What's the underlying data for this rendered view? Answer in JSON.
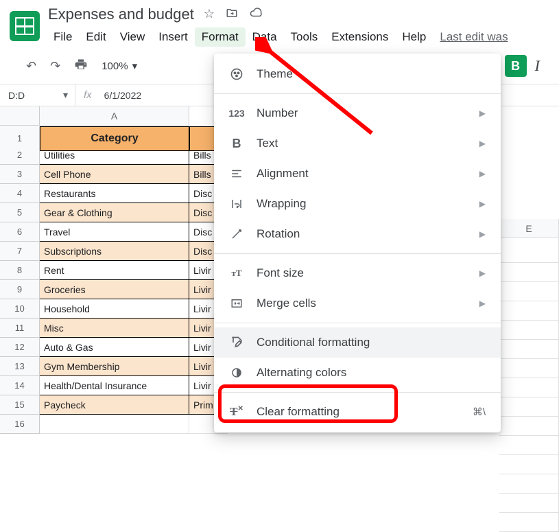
{
  "doc": {
    "title": "Expenses and budget",
    "last_edit": "Last edit was"
  },
  "menubar": [
    "File",
    "Edit",
    "View",
    "Insert",
    "Format",
    "Data",
    "Tools",
    "Extensions",
    "Help"
  ],
  "toolbar": {
    "zoom": "100%"
  },
  "formula": {
    "name_box": "D:D",
    "value": "6/1/2022"
  },
  "columns": {
    "A": "A",
    "E": "E"
  },
  "header_row": {
    "A": "Category"
  },
  "rows": [
    {
      "n": "2",
      "a": "Utilities",
      "b": "Bills"
    },
    {
      "n": "3",
      "a": "Cell Phone",
      "b": "Bills",
      "alt": true
    },
    {
      "n": "4",
      "a": "Restaurants",
      "b": "Disc"
    },
    {
      "n": "5",
      "a": "Gear & Clothing",
      "b": "Disc",
      "alt": true
    },
    {
      "n": "6",
      "a": "Travel",
      "b": "Disc"
    },
    {
      "n": "7",
      "a": "Subscriptions",
      "b": "Disc",
      "alt": true
    },
    {
      "n": "8",
      "a": "Rent",
      "b": "Livir"
    },
    {
      "n": "9",
      "a": "Groceries",
      "b": "Livir",
      "alt": true
    },
    {
      "n": "10",
      "a": "Household",
      "b": "Livir"
    },
    {
      "n": "11",
      "a": "Misc",
      "b": "Livir",
      "alt": true
    },
    {
      "n": "12",
      "a": "Auto & Gas",
      "b": "Livir"
    },
    {
      "n": "13",
      "a": "Gym Membership",
      "b": "Livir",
      "alt": true
    },
    {
      "n": "14",
      "a": "Health/Dental Insurance",
      "b": "Livir"
    },
    {
      "n": "15",
      "a": "Paycheck",
      "b": "Prim",
      "alt": true
    },
    {
      "n": "16",
      "a": "",
      "b": ""
    }
  ],
  "format_menu": {
    "theme": "Theme",
    "number": "Number",
    "text": "Text",
    "alignment": "Alignment",
    "wrapping": "Wrapping",
    "rotation": "Rotation",
    "font_size": "Font size",
    "merge": "Merge cells",
    "cond": "Conditional formatting",
    "alt": "Alternating colors",
    "clear": "Clear formatting",
    "clear_sc": "⌘\\"
  }
}
